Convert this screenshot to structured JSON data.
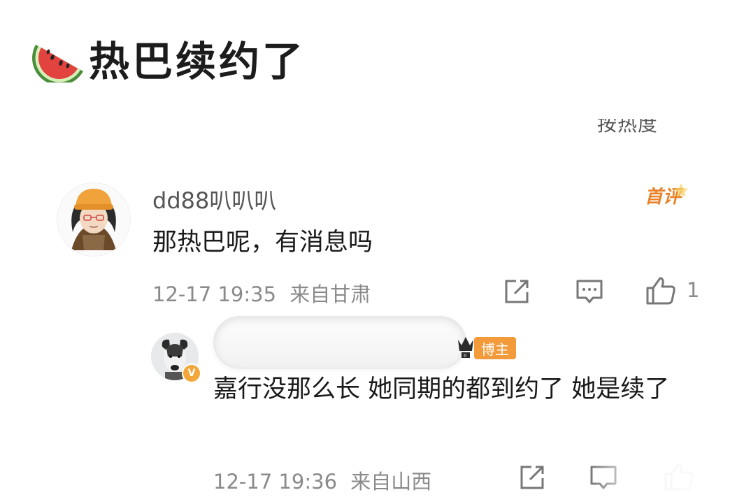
{
  "post": {
    "title": "热巴续约了",
    "title_icon": "watermelon-icon"
  },
  "sort_bar": {
    "label": "按热度"
  },
  "comments": [
    {
      "username": "dd88叭叭叭",
      "badge": "首评",
      "text": "那热巴呢，有消息吗",
      "timestamp": "12-17 19:35",
      "location": "来自甘肃",
      "like_count": "1"
    },
    {
      "role_badge": "博主",
      "verified_badge": "V",
      "text": "嘉行没那么长 她同期的都到约了 她是续了",
      "timestamp": "12-17 19:36",
      "location": "来自山西"
    }
  ],
  "colors": {
    "host_badge": "#f39a3a",
    "first_comment_badge": "#e8822a",
    "meta_text": "#8a8a8a"
  }
}
